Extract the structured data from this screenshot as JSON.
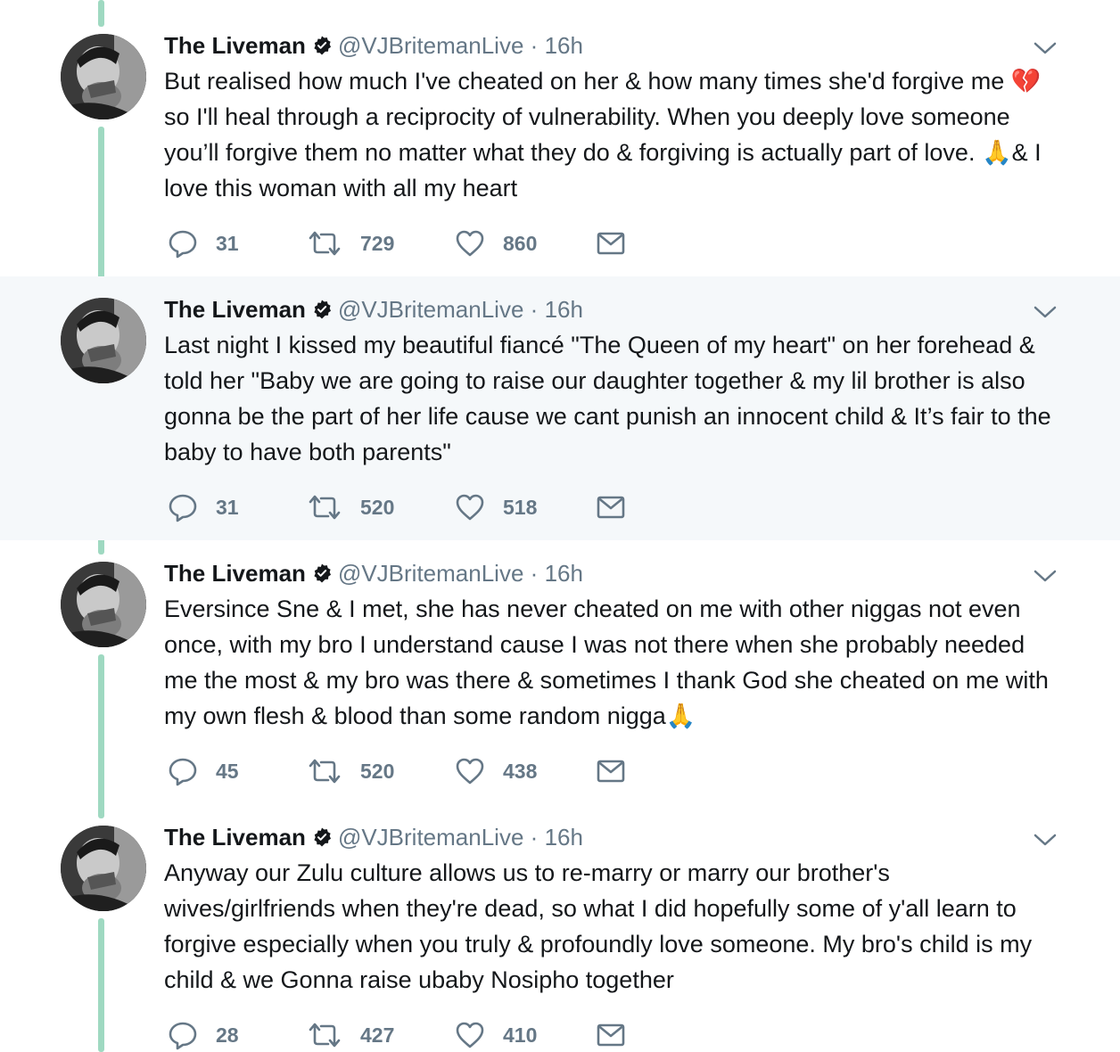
{
  "author": {
    "name": "The Liveman",
    "handle": "@VJBritemanLive",
    "separator": "·",
    "time": "16h"
  },
  "icons": {
    "verified": "verified-badge-icon",
    "reply": "reply-icon",
    "retweet": "retweet-icon",
    "like": "heart-icon",
    "dm": "envelope-icon",
    "caret": "chevron-down-icon"
  },
  "colors": {
    "thread_line": "#9fd9c1",
    "highlight_bg": "#f5f8fa",
    "muted_text": "#657786"
  },
  "tweets": [
    {
      "text": "But realised how much I've cheated on her & how many times she'd forgive me 💔 so I'll heal through a reciprocity of vulnerability. When you deeply love someone you’ll forgive them no matter what they do & forgiving is actually part of love. 🙏& I love this woman with all my heart",
      "replies": "31",
      "retweets": "729",
      "likes": "860"
    },
    {
      "text": "Last night I kissed my beautiful fiancé \"The Queen of my heart\" on her forehead & told her \"Baby we are going to raise our daughter together & my lil brother is also gonna be the part of her life cause we cant punish an innocent child & It’s fair to the baby to have both parents\"",
      "replies": "31",
      "retweets": "520",
      "likes": "518"
    },
    {
      "text": "Eversince Sne & I met, she has never cheated on me with other niggas not even once, with my bro I understand cause I was not there when she probably needed me the most & my bro was there & sometimes I thank God she cheated on me with my own flesh & blood than some random nigga🙏",
      "replies": "45",
      "retweets": "520",
      "likes": "438"
    },
    {
      "text": "Anyway our Zulu culture allows us to re-marry or marry our brother's wives/girlfriends when they're dead, so what I did hopefully some of y'all learn to forgive especially when you truly & profoundly love someone. My bro's child is my child & we Gonna raise ubaby Nosipho together",
      "replies": "28",
      "retweets": "427",
      "likes": "410"
    }
  ]
}
